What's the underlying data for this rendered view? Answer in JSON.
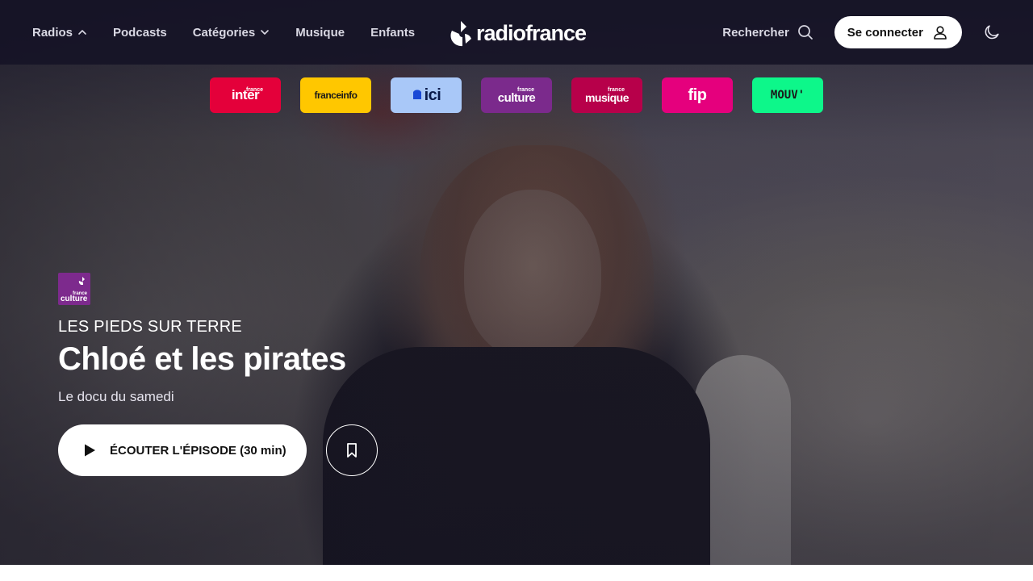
{
  "nav": {
    "radios": "Radios",
    "podcasts": "Podcasts",
    "categories": "Catégories",
    "music": "Musique",
    "kids": "Enfants",
    "logo": "radiofrance",
    "search": "Rechercher",
    "login": "Se connecter"
  },
  "stations": [
    {
      "name": "inter",
      "small": "france",
      "color": "#e4003a",
      "text_color": "#ffffff"
    },
    {
      "name": "franceinfo",
      "small": "",
      "color": "#ffc700",
      "text_color": "#1a1a1a"
    },
    {
      "name": "ici",
      "small": "",
      "color": "#a9c8f8",
      "text_color": "#0a1a4a"
    },
    {
      "name": "culture",
      "small": "france",
      "color": "#7b2a8c",
      "text_color": "#ffffff"
    },
    {
      "name": "musique",
      "small": "france",
      "color": "#b7004a",
      "text_color": "#ffffff"
    },
    {
      "name": "fip",
      "small": "",
      "color": "#e5007d",
      "text_color": "#ffffff"
    },
    {
      "name": "MOUV'",
      "small": "",
      "color": "#0df78a",
      "text_color": "#1a1a1a"
    }
  ],
  "episode": {
    "station_badge": {
      "small": "france",
      "word": "culture"
    },
    "show": "LES PIEDS SUR TERRE",
    "title": "Chloé et les pirates",
    "subtitle": "Le docu du samedi",
    "play_label": "ÉCOUTER L'ÉPISODE (30 min)"
  },
  "icons": {
    "chevron": "chevron-down-icon",
    "search": "search-icon",
    "user": "user-icon",
    "theme": "moon-icon",
    "play": "play-icon",
    "bookmark": "bookmark-icon"
  }
}
